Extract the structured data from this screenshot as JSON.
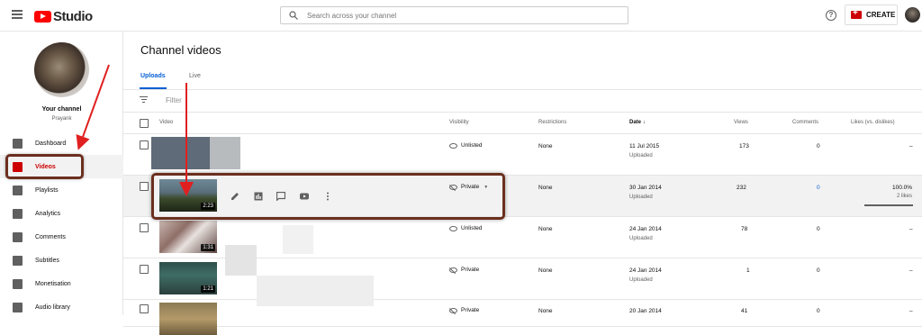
{
  "header": {
    "brand": "Studio",
    "search_placeholder": "Search across your channel",
    "create_label": "CREATE",
    "help_glyph": "?"
  },
  "sidebar": {
    "channel_label": "Your channel",
    "channel_name": "Prayank",
    "items": [
      {
        "label": "Dashboard",
        "icon": "dashboard-icon"
      },
      {
        "label": "Videos",
        "icon": "videos-icon",
        "active": true
      },
      {
        "label": "Playlists",
        "icon": "playlists-icon"
      },
      {
        "label": "Analytics",
        "icon": "analytics-icon"
      },
      {
        "label": "Comments",
        "icon": "comments-icon"
      },
      {
        "label": "Subtitles",
        "icon": "subtitles-icon"
      },
      {
        "label": "Monetisation",
        "icon": "monetisation-icon"
      },
      {
        "label": "Audio library",
        "icon": "audio-library-icon"
      }
    ]
  },
  "main": {
    "title": "Channel videos",
    "tabs": [
      {
        "label": "Uploads",
        "active": true
      },
      {
        "label": "Live"
      }
    ],
    "filter_label": "Filter",
    "columns": {
      "video": "Video",
      "visibility": "Visibility",
      "restrictions": "Restrictions",
      "date": "Date",
      "views": "Views",
      "comments": "Comments",
      "likes": "Likes (vs. dislikes)"
    },
    "rows": [
      {
        "visibility": "Unlisted",
        "restrictions": "None",
        "date": "11 Jul 2015",
        "date_sub": "Uploaded",
        "views": "173",
        "comments": "0",
        "likes": "–"
      },
      {
        "duration": "2:23",
        "visibility": "Private",
        "restrictions": "None",
        "date": "30 Jan 2014",
        "date_sub": "Uploaded",
        "views": "232",
        "comments": "0",
        "likes": "100.0%",
        "likes_sub": "2 likes",
        "likes_fraction": 1.0
      },
      {
        "duration": "1:31",
        "visibility": "Unlisted",
        "restrictions": "None",
        "date": "24 Jan 2014",
        "date_sub": "Uploaded",
        "views": "78",
        "comments": "0",
        "likes": "–"
      },
      {
        "duration": "1:21",
        "visibility": "Private",
        "restrictions": "None",
        "date": "24 Jan 2014",
        "date_sub": "Uploaded",
        "views": "1",
        "comments": "0",
        "likes": "–"
      },
      {
        "visibility": "Private",
        "restrictions": "None",
        "date": "20 Jan 2014",
        "views": "41",
        "comments": "0",
        "likes": "–"
      }
    ]
  },
  "colors": {
    "accent_red": "#cc0000",
    "link_blue": "#065fd4",
    "annotation_red": "#e02020",
    "annotation_box": "#6b2f1e"
  }
}
